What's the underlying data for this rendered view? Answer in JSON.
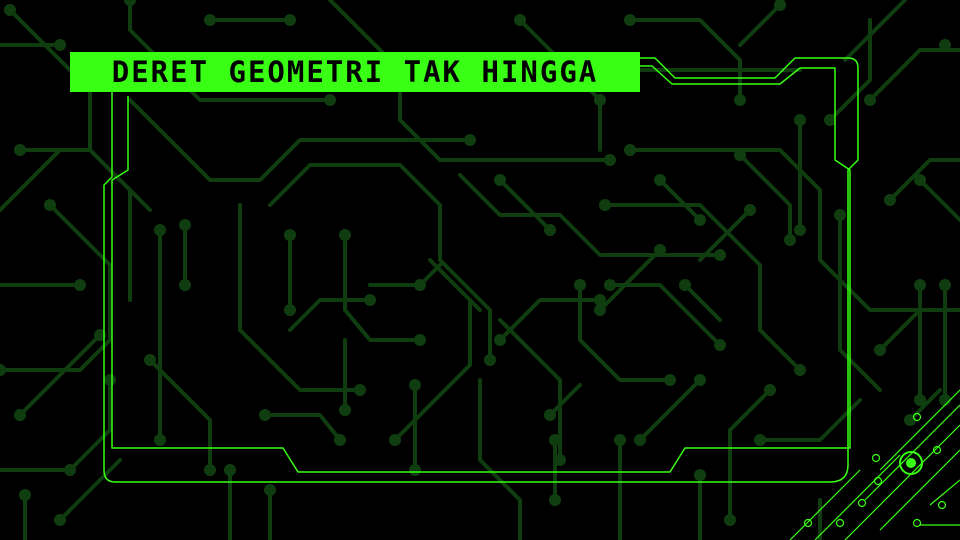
{
  "slide": {
    "title": "DERET GEOMETRI TAK HINGGA"
  },
  "colors": {
    "background": "#000000",
    "circuit": "#0f3d0f",
    "neon": "#39ff14"
  },
  "icons": {
    "background": "circuit-board-pattern",
    "frame": "hud-frame",
    "corner": "circuit-node-icon"
  }
}
